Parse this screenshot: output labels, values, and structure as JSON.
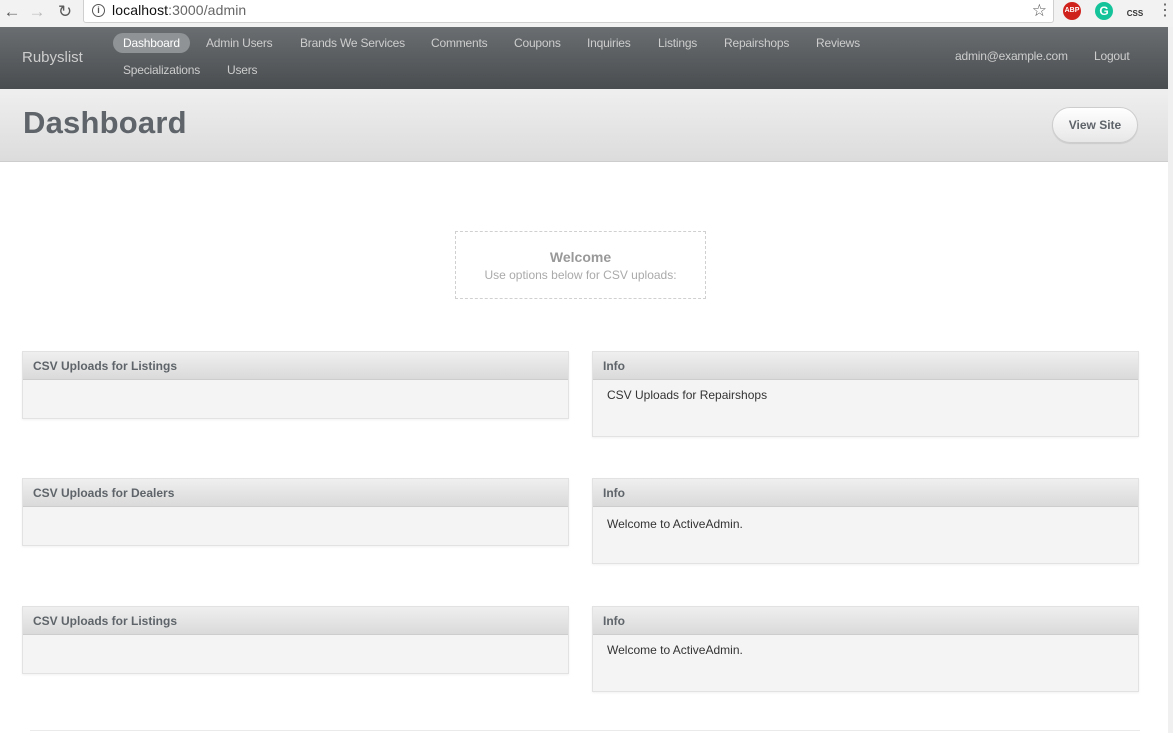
{
  "browser": {
    "url_host": "localhost",
    "url_path": ":3000/admin",
    "back_glyph": "←",
    "forward_glyph": "→",
    "reload_glyph": "↻",
    "star_glyph": "☆",
    "ext_abp": "ABP",
    "ext_g": "G",
    "ext_css": "CSS",
    "menu_glyph": "⋮"
  },
  "header": {
    "site_title": "Rubyslist",
    "menu": [
      {
        "label": "Dashboard",
        "current": true
      },
      {
        "label": "Admin Users"
      },
      {
        "label": "Brands We Services"
      },
      {
        "label": "Comments"
      },
      {
        "label": "Coupons"
      },
      {
        "label": "Inquiries"
      },
      {
        "label": "Listings"
      },
      {
        "label": "Repairshops"
      },
      {
        "label": "Reviews"
      },
      {
        "label": "Specializations"
      },
      {
        "label": "Users"
      }
    ],
    "current_user": "admin@example.com",
    "logout": "Logout"
  },
  "title_bar": {
    "title": "Dashboard",
    "view_site": "View Site"
  },
  "welcome": {
    "title": "Welcome",
    "subtitle": "Use options below for CSV uploads:"
  },
  "panels": [
    {
      "title": "CSV Uploads for Listings",
      "body": ""
    },
    {
      "title": "Info",
      "body": "CSV Uploads for Repairshops"
    },
    {
      "title": "CSV Uploads for Dealers",
      "body": ""
    },
    {
      "title": "Info",
      "body": "Welcome to ActiveAdmin."
    },
    {
      "title": "CSV Uploads for Listings",
      "body": ""
    },
    {
      "title": "Info",
      "body": "Welcome to ActiveAdmin."
    }
  ],
  "colors": {
    "header_bg": "#5b5f62",
    "title_text": "#5e6469",
    "current_tab": "#8f9396"
  }
}
